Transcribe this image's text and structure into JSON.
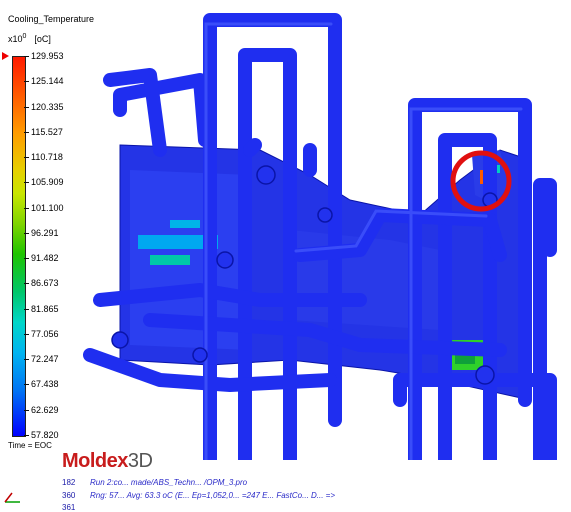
{
  "legend": {
    "title": "Cooling_Temperature",
    "scale_base": "x10",
    "scale_exp": "0",
    "unit": "[oC]",
    "ticks": [
      "129.953",
      "125.144",
      "120.335",
      "115.527",
      "110.718",
      "105.909",
      "101.100",
      "96.291",
      "91.482",
      "86.673",
      "81.865",
      "77.056",
      "72.247",
      "67.438",
      "62.629",
      "57.820"
    ],
    "time_label": "Time = EOC"
  },
  "logo": {
    "main": "Moldex",
    "suffix": "3D"
  },
  "info": {
    "lines": [
      {
        "num": "182",
        "text": "Run 2:co... made/ABS_Techn... /OPM_3.pro"
      },
      {
        "num": "360",
        "text": "Rng: 57... Avg: 63.3 oC (E... Ep=1,052,0... =247 E... FastCo... D... =>"
      },
      {
        "num": "361",
        "text": ""
      }
    ]
  },
  "colors": {
    "pipe": "#1f2ef0",
    "pipe_dark": "#0a14a8",
    "part": "#2a3ce8",
    "highlight_ring": "#e01010"
  }
}
